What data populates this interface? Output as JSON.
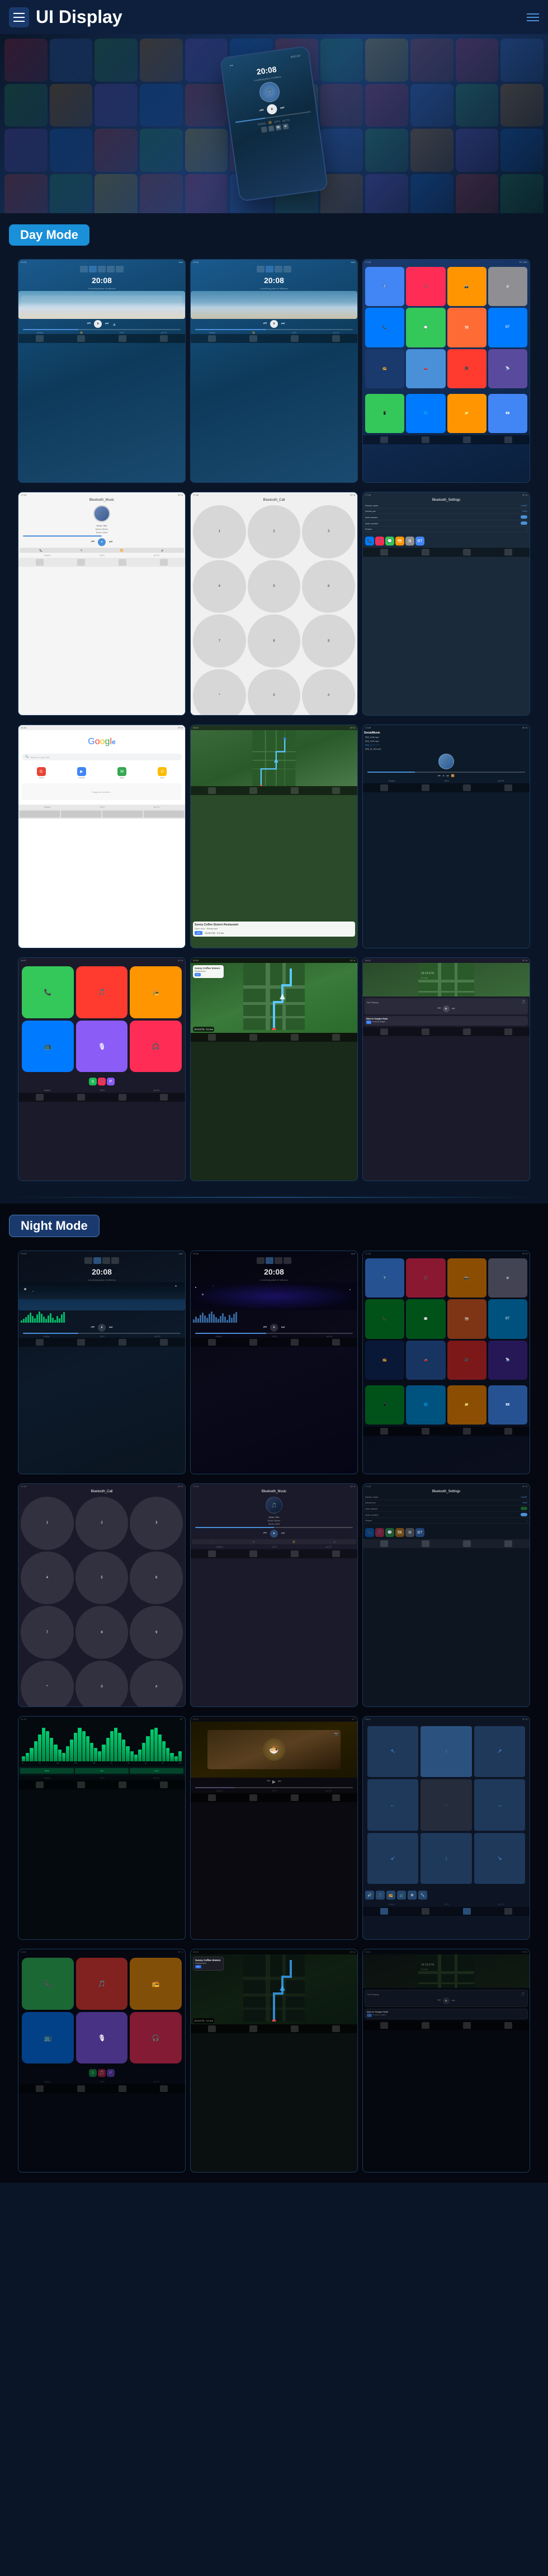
{
  "header": {
    "title": "UI Display",
    "menu_label": "Menu",
    "lines_label": "Lines"
  },
  "sections": {
    "day_mode": "Day Mode",
    "night_mode": "Night Mode"
  },
  "screens": {
    "time": "20:08",
    "music_title": "Music Title",
    "music_album": "Music Album",
    "music_artist": "Music Artist",
    "bluetooth_music": "Bluetooth_Music",
    "bluetooth_call": "Bluetooth_Call",
    "bluetooth_settings": "Bluetooth_Settings",
    "device_name": "CarBT",
    "device_pin": "0000",
    "auto_answer": "Auto answer",
    "auto_connect": "Auto connect",
    "flower": "Flower",
    "google": "Google",
    "social_music": "SocialMusic",
    "sunny_coffee": "Sunny Coffee\nSistern\nRestaurant",
    "eta_label": "18:18 ETA",
    "distance": "9.0 km",
    "go_label": "GO",
    "not_playing": "Not Playing",
    "start_on": "Start on\nGonglue\nRoad",
    "dial_buttons": [
      "1",
      "2",
      "3",
      "4",
      "5",
      "6",
      "7",
      "8",
      "9",
      "*",
      "0",
      "#"
    ]
  },
  "colors": {
    "accent_blue": "#4a90d9",
    "day_badge": "#1a90d9",
    "night_badge": "#1a3a6e",
    "background_dark": "#0a1628",
    "background_darker": "#050810",
    "green_accent": "#00cc44",
    "wave_color": "#00ff88"
  },
  "wave_heights": [
    4,
    7,
    10,
    14,
    18,
    12,
    8,
    15,
    20,
    16,
    11,
    7,
    13,
    17,
    9,
    5,
    12,
    8,
    15,
    19,
    14,
    10,
    6,
    11,
    16,
    20,
    15,
    9,
    7,
    12
  ],
  "wave_heights_2": [
    6,
    11,
    8,
    14,
    18,
    13,
    9,
    16,
    20,
    15,
    10,
    7,
    12,
    17,
    11,
    5,
    14,
    9,
    16,
    19,
    13,
    8,
    6,
    10,
    15,
    19,
    14,
    8,
    6,
    11
  ],
  "app_colors": {
    "phone": "#34c759",
    "messages": "#34c759",
    "safari": "#007aff",
    "music": "#ff2d55",
    "maps": "#ff6b35",
    "settings": "#8e8e93",
    "camera": "#8e8e93",
    "photos": "#ff9500",
    "mail": "#007aff",
    "facetime": "#34c759",
    "calendar": "#ff3b30",
    "contacts": "#34c759",
    "notes": "#ffcc00",
    "reminders": "#ff3b30",
    "podcasts": "#8b5cf6",
    "news": "#ff3b30",
    "stocks": "#34c759",
    "health": "#ff2d55",
    "wallet": "#000000",
    "appstore": "#007aff",
    "tv": "#000000",
    "find": "#34c759",
    "bt": "#007aff",
    "radio": "#ff9500",
    "navi": "#007aff",
    "video": "#ff3b30",
    "spotify": "#1db954",
    "waze": "#6ec6ff"
  }
}
